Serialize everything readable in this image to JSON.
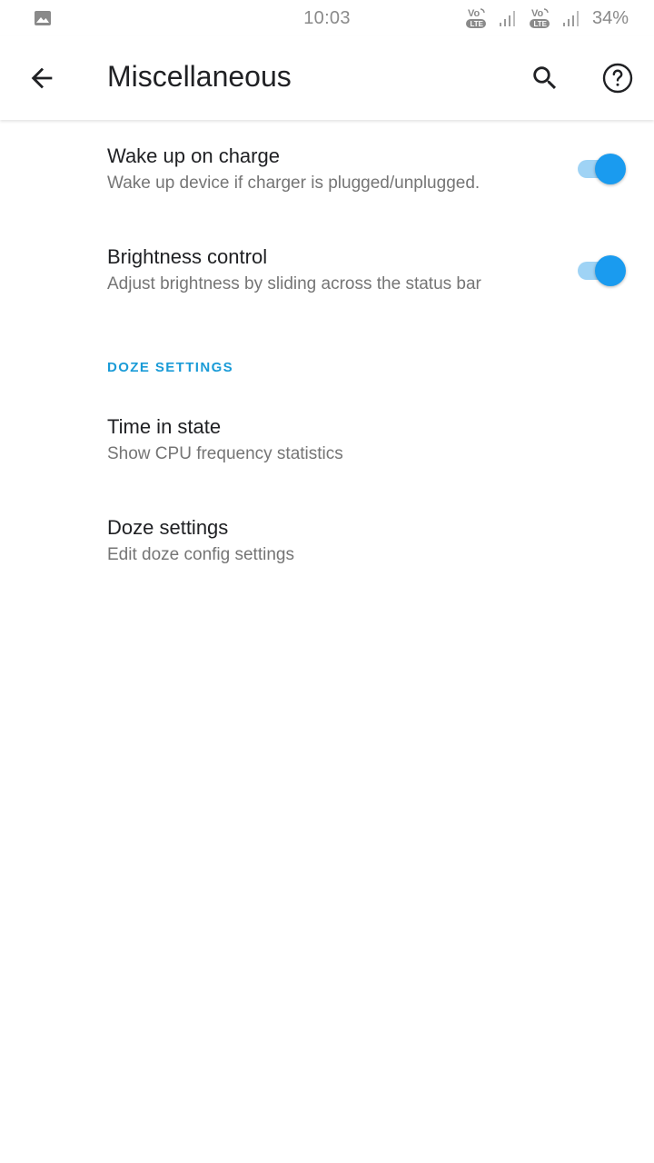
{
  "status_bar": {
    "time": "10:03",
    "battery": "34%",
    "volte_label_top": "Vo",
    "volte_label_bottom": "LTE",
    "icons": [
      "gallery-icon",
      "volte-icon",
      "signal-icon",
      "volte-icon",
      "signal-icon"
    ]
  },
  "app_bar": {
    "title": "Miscellaneous",
    "icons": [
      "back-arrow-icon",
      "search-icon",
      "help-icon"
    ]
  },
  "preferences": [
    {
      "title": "Wake up on charge",
      "summary": "Wake up device if charger is plugged/unplugged.",
      "toggle_on": true
    },
    {
      "title": "Brightness control",
      "summary": "Adjust brightness by sliding across the status bar",
      "toggle_on": true
    }
  ],
  "doze_section": {
    "header": "DOZE SETTINGS",
    "items": [
      {
        "title": "Time in state",
        "summary": "Show CPU frequency statistics"
      },
      {
        "title": "Doze settings",
        "summary": "Edit doze config settings"
      }
    ]
  },
  "colors": {
    "accent": "#1a9bef",
    "accent_track": "#9fd3f5",
    "section_header": "#1a9bd7"
  }
}
